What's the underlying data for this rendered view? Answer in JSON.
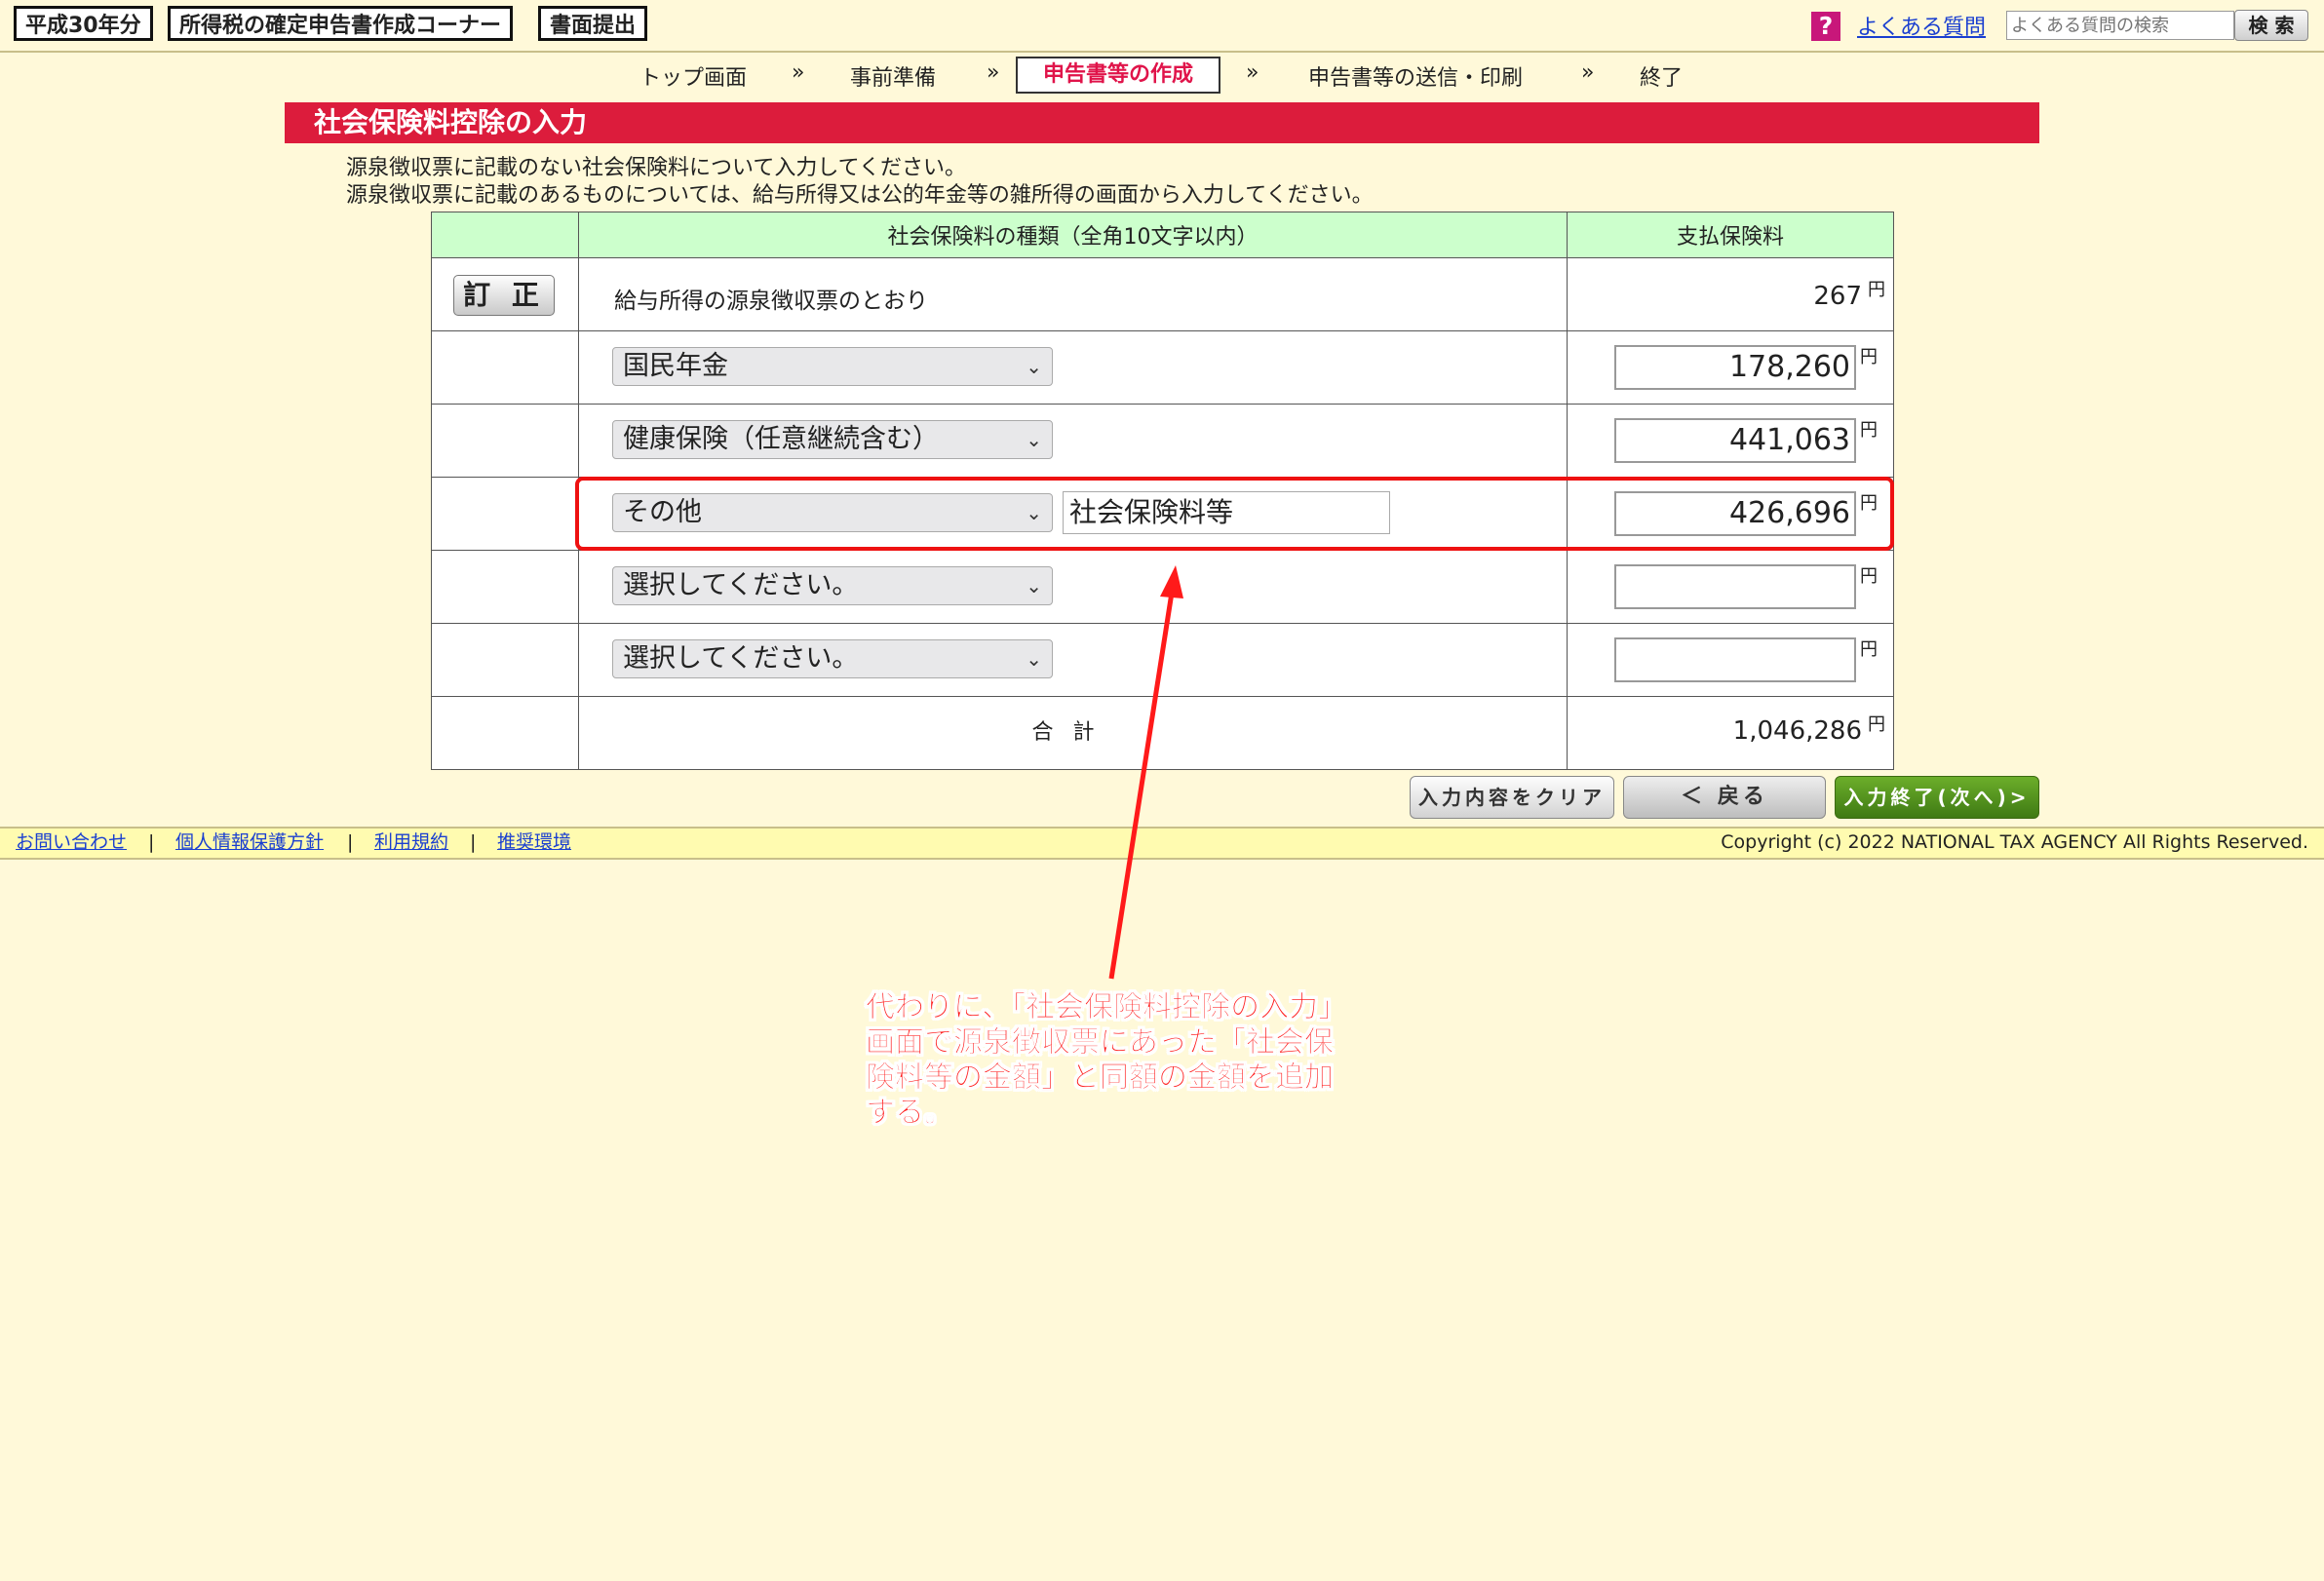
{
  "header": {
    "tags": [
      "平成30年分",
      "所得税の確定申告書作成コーナー",
      "書面提出"
    ],
    "faq_label": "よくある質問",
    "search_placeholder": "よくある質問の検索",
    "search_button": "検 索",
    "help_icon": "?"
  },
  "steps": {
    "items": [
      "トップ画面",
      "事前準備",
      "申告書等の作成",
      "申告書等の送信・印刷",
      "終了"
    ],
    "current_index": 2,
    "separator": "»"
  },
  "section": {
    "title": "社会保険料控除の入力",
    "instructions": [
      "源泉徴収票に記載のない社会保険料について入力してください。",
      "源泉徴収票に記載のあるものについては、給与所得又は公的年金等の雑所得の画面から入力してください。"
    ]
  },
  "table": {
    "col_type": "社会保険料の種類（全角10文字以内）",
    "col_amount": "支払保険料",
    "yen": "円",
    "rows": [
      {
        "action": "訂 正",
        "type_text": "給与所得の源泉徴収票のとおり",
        "amount": "267"
      },
      {
        "select": "国民年金",
        "amount": "178,260"
      },
      {
        "select": "健康保険（任意継続含む）",
        "amount": "441,063"
      },
      {
        "select": "その他",
        "text": "社会保険料等",
        "amount": "426,696"
      },
      {
        "select": "選択してください。",
        "amount": ""
      },
      {
        "select": "選択してください。",
        "amount": ""
      }
    ],
    "total_label": "合計",
    "total": "1,046,286"
  },
  "buttons": {
    "clear": "入力内容をクリア",
    "back": "＜ 戻る",
    "next": "入力終了(次へ)>"
  },
  "footer": {
    "links": [
      "お問い合わせ",
      "個人情報保護方針",
      "利用規約",
      "推奨環境"
    ],
    "separator": "|",
    "copyright": "Copyright (c) 2022 NATIONAL TAX AGENCY All Rights Reserved."
  },
  "annotation": {
    "lines": [
      "代わりに、「社会保険料控除の入力」",
      "画面で源泉徴収票にあった「社会保",
      "険料等の金額」と同額の金額を追加",
      "する。"
    ],
    "color": "#ff1a1a"
  }
}
